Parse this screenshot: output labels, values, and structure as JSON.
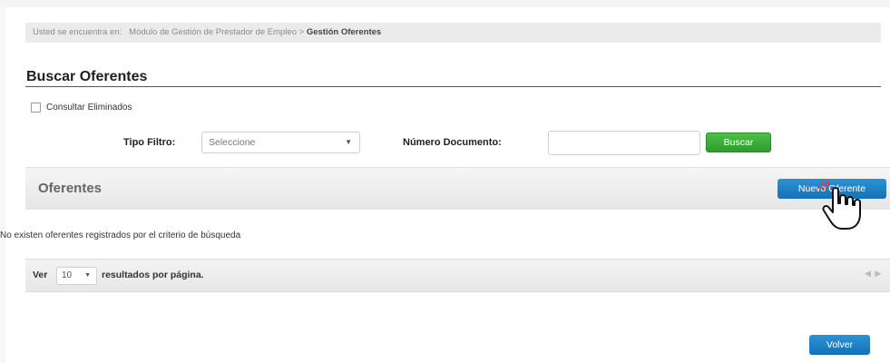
{
  "breadcrumb": {
    "prefix": "Usted se encuentra en:",
    "module": "Módulo de Gestión de Prestador de Empleo",
    "separator": ">",
    "current": "Gestión Oferentes"
  },
  "page_title": "Buscar Oferentes",
  "filters": {
    "consultar_eliminados_label": "Consultar Eliminados",
    "consultar_eliminados_checked": false,
    "tipo_filtro_label": "Tipo Filtro:",
    "tipo_filtro_value": "Seleccione",
    "numero_documento_label": "Número Documento:",
    "numero_documento_value": "",
    "buscar_label": "Buscar"
  },
  "panel": {
    "title": "Oferentes",
    "nuevo_button_label": "Nuevo Oferente",
    "empty_message": "No existen oferentes registrados por el criterio de búsqueda"
  },
  "pager": {
    "ver_label": "Ver",
    "per_page_value": "10",
    "per_page_suffix": "resultados por página.",
    "arrows": "◀ ▶"
  },
  "volver_label": "Volver",
  "colors": {
    "green_button": "#3aab39",
    "blue_button": "#1e82c8",
    "breadcrumb_bg": "#ebebeb"
  }
}
